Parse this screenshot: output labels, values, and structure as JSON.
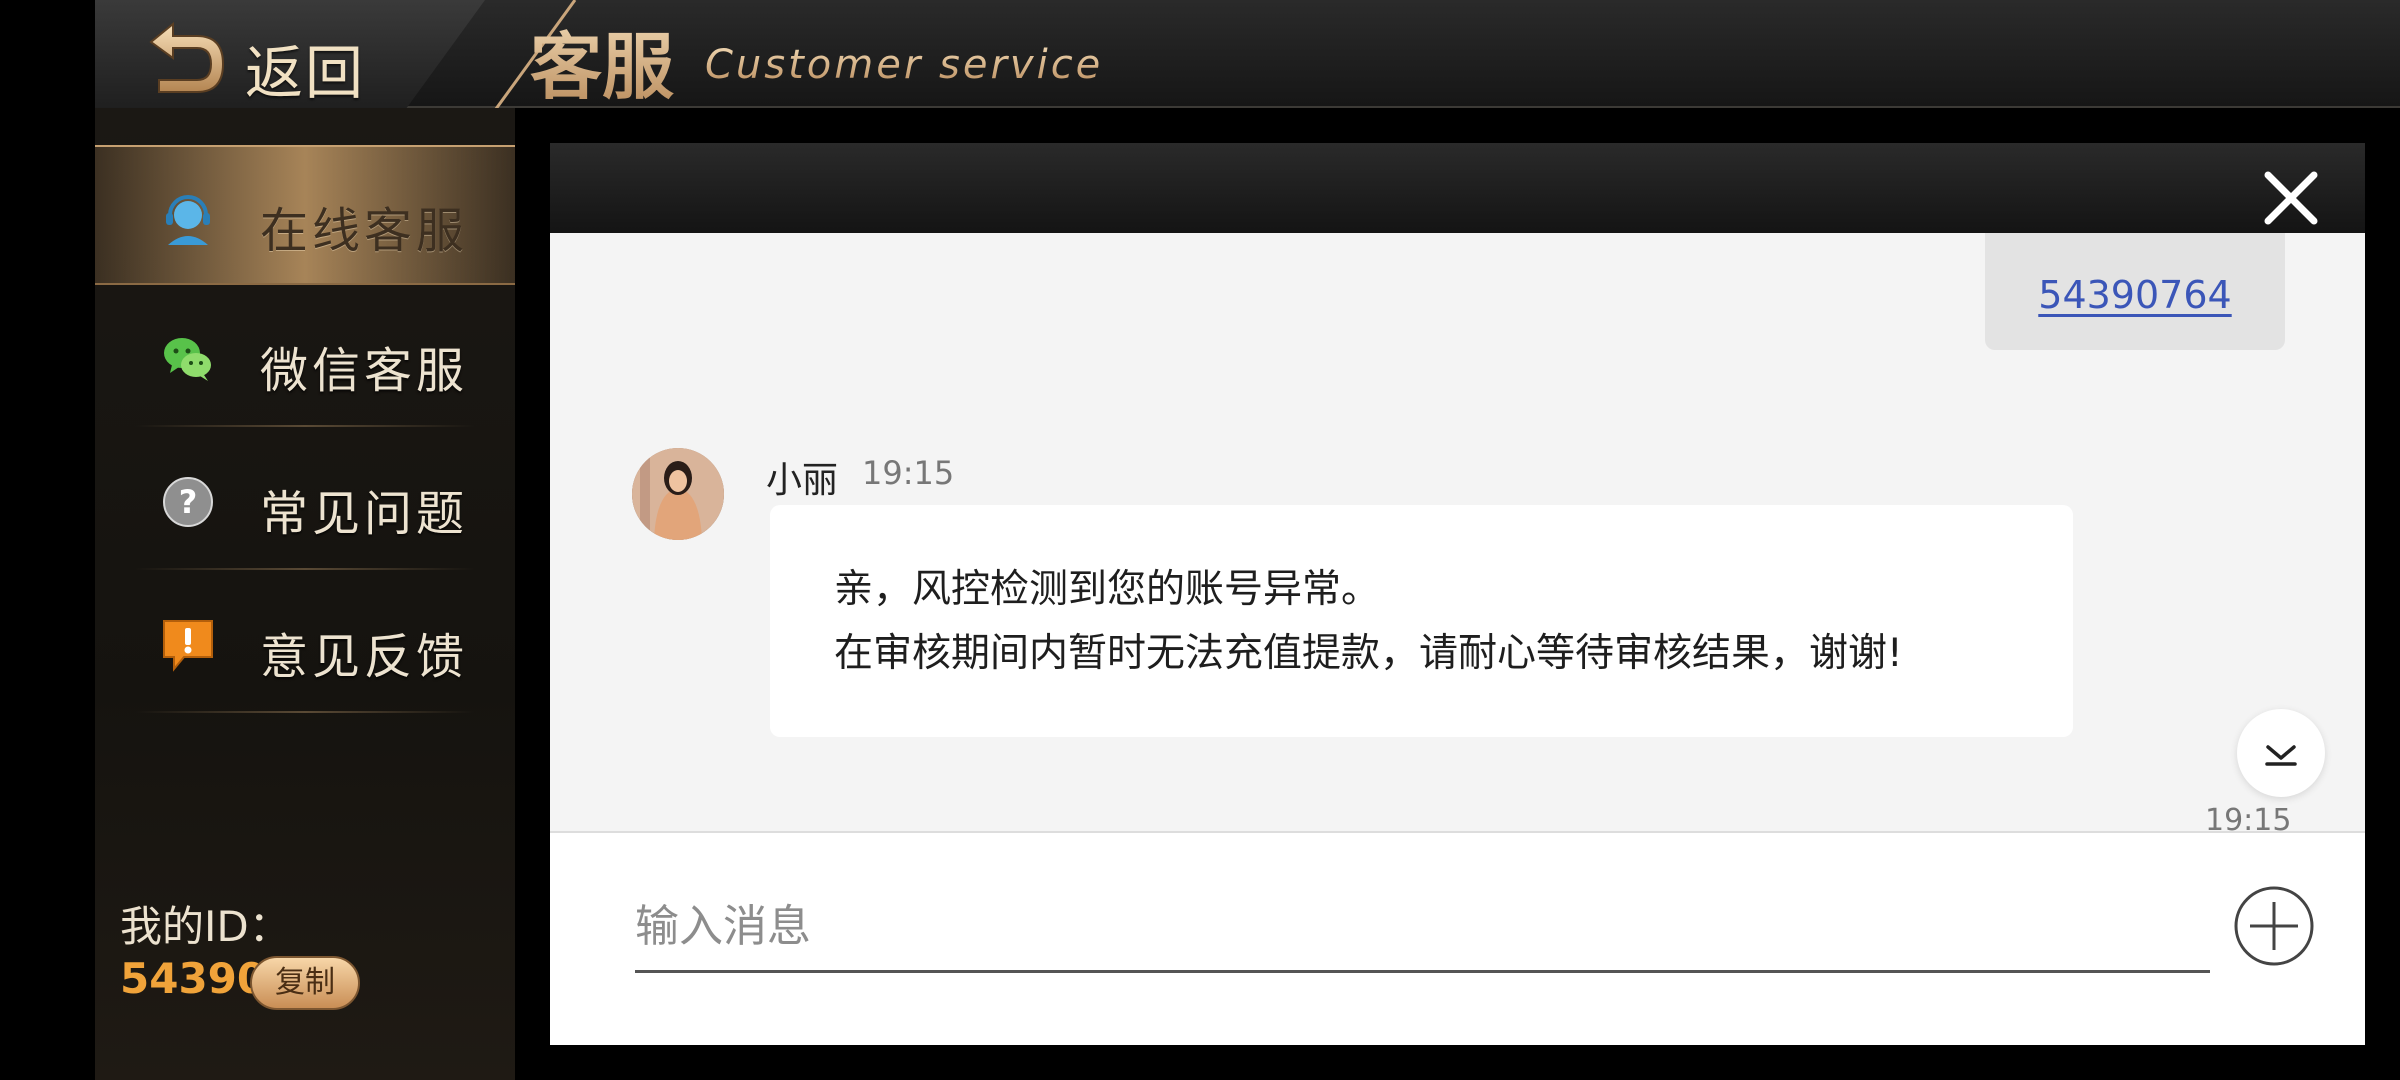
{
  "header": {
    "back_label": "返回",
    "title": "客服",
    "subtitle": "Customer service"
  },
  "sidebar": {
    "items": [
      {
        "label": "在线客服",
        "icon": "headset-icon",
        "active": true
      },
      {
        "label": "微信客服",
        "icon": "wechat-icon",
        "active": false
      },
      {
        "label": "常见问题",
        "icon": "question-icon",
        "active": false
      },
      {
        "label": "意见反馈",
        "icon": "feedback-icon",
        "active": false
      }
    ],
    "my_id_label": "我的ID：",
    "my_id_value": "54390764",
    "copy_label": "复制"
  },
  "chat": {
    "sent_message": "54390764",
    "agent": {
      "name": "小丽",
      "time": "19:15"
    },
    "received_lines": [
      "亲，风控检测到您的账号异常。",
      "在审核期间内暂时无法充值提款，请耐心等待审核结果，谢谢!"
    ],
    "bottom_time": "19:15",
    "input_placeholder": "输入消息"
  },
  "colors": {
    "accent_gold": "#c9a57b",
    "id_orange": "#f0a33a",
    "link_blue": "#3b56b8"
  }
}
